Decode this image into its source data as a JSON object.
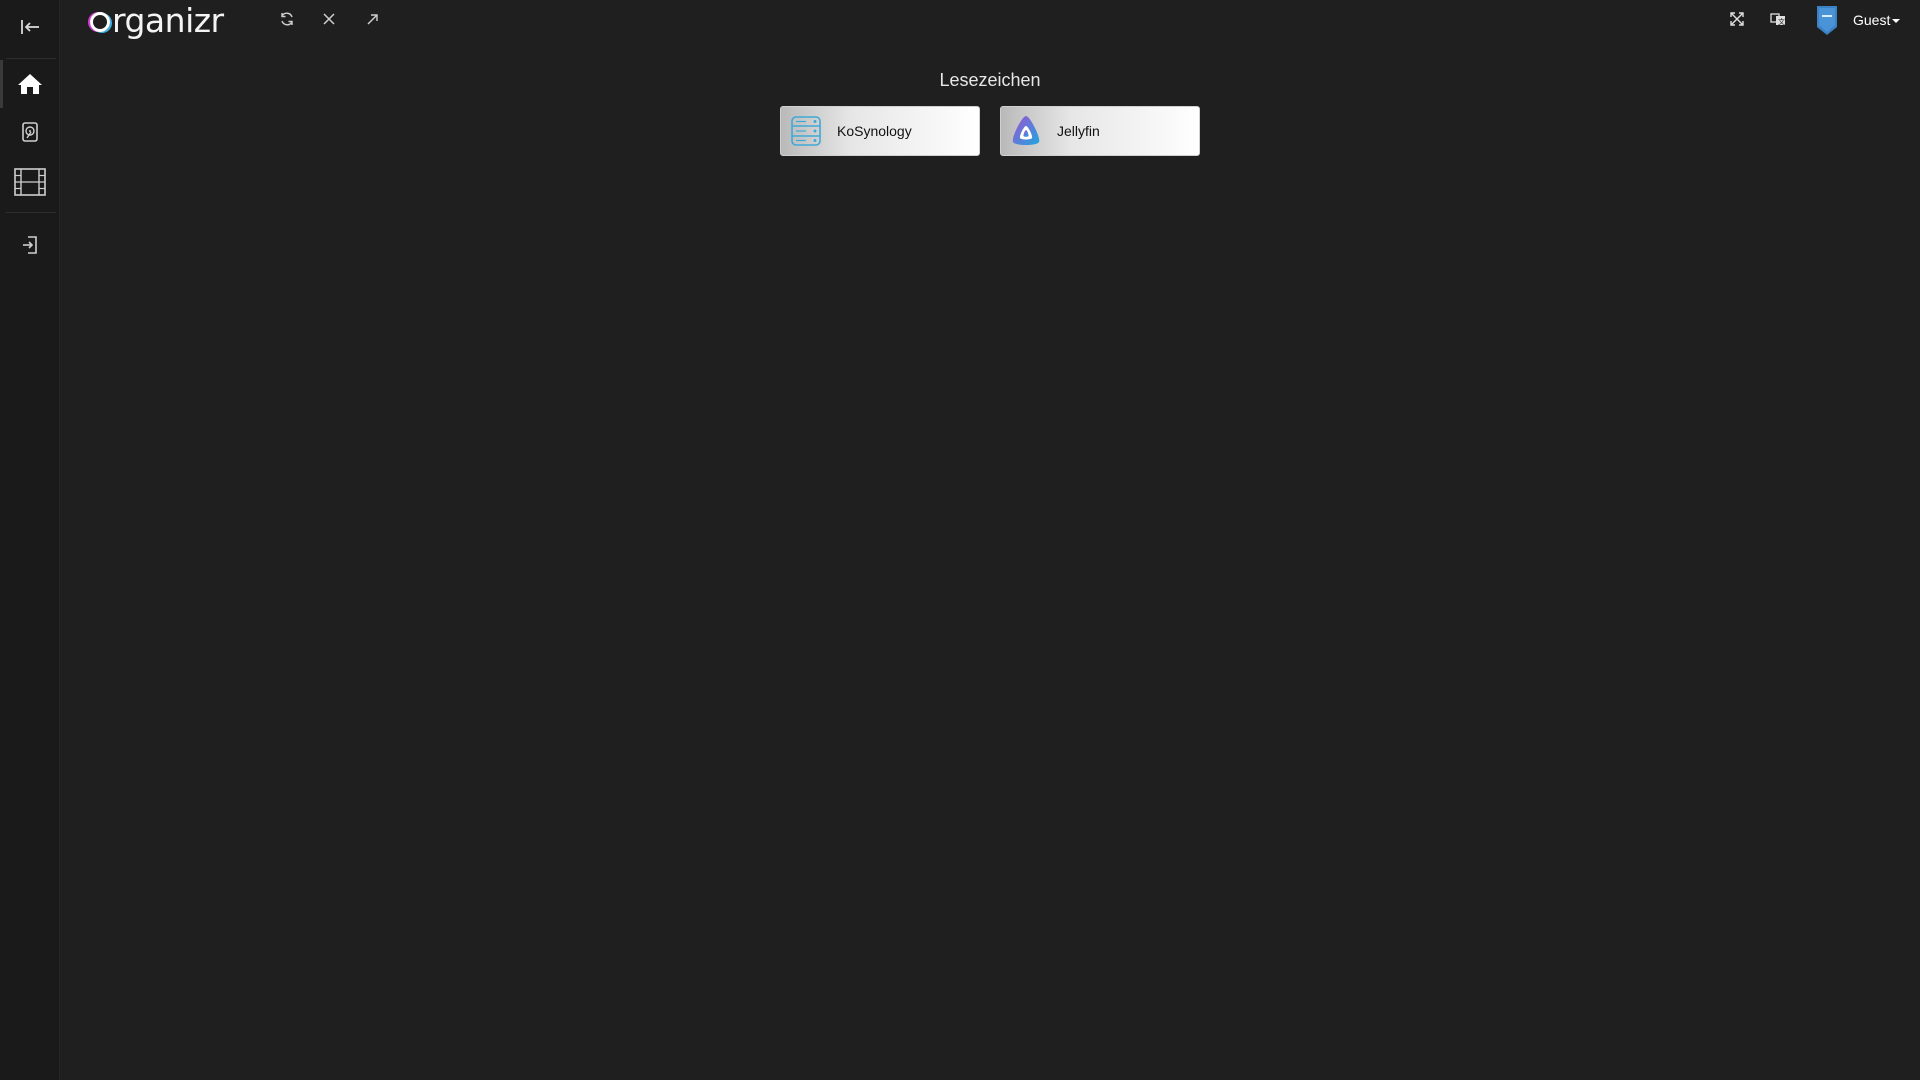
{
  "app": {
    "logo_text": "rganizr"
  },
  "sidebar": {
    "items": [
      {
        "name": "collapse",
        "icon": "collapse-left-icon"
      },
      {
        "name": "home",
        "icon": "home-icon",
        "active": true
      },
      {
        "name": "hdd",
        "icon": "hard-drive-icon"
      },
      {
        "name": "movies",
        "icon": "film-icon"
      },
      {
        "name": "login",
        "icon": "login-icon"
      }
    ]
  },
  "toolbar": {
    "icons": [
      "reload-icon",
      "close-icon",
      "open-new-window-icon"
    ]
  },
  "header_right": {
    "icons": [
      "fullscreen-icon",
      "translate-icon"
    ],
    "user": {
      "name": "Guest",
      "avatar_icon": "shield-avatar-icon"
    }
  },
  "main": {
    "section_title": "Lesezeichen",
    "bookmarks": [
      {
        "label": "KoSynology",
        "icon": "server-icon",
        "color": "#3ea9d8"
      },
      {
        "label": "Jellyfin",
        "icon": "jellyfin-icon",
        "color": "#a14fd0"
      }
    ]
  },
  "colors": {
    "background": "#1f1f1f",
    "sidebar": "#1a1a1a",
    "accent_blue": "#3b82c4"
  }
}
